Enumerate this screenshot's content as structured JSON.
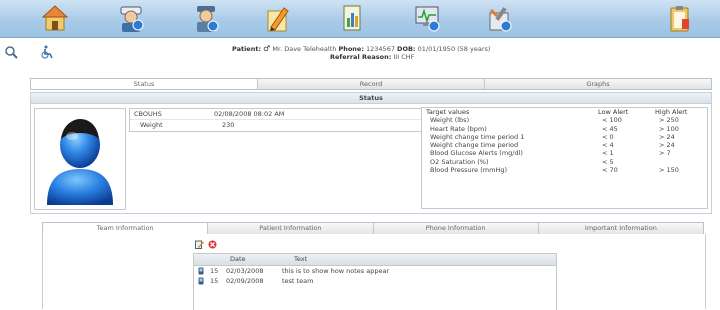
{
  "toolbar": {
    "icons": [
      "home-icon",
      "nurse-settings-icon",
      "doctor-settings-icon",
      "edit-icon",
      "chart-report-icon",
      "monitor-icon",
      "tools-icon",
      "clipboard-icon"
    ]
  },
  "patient": {
    "label": "Patient:",
    "gender_symbol": "♂",
    "name": "Mr. Dave Telehealth",
    "phone_label": "Phone:",
    "phone": "1234567",
    "dob_label": "DOB:",
    "dob": "01/01/1950 (58 years)",
    "referral_label": "Referral Reason:",
    "referral": "III CHF"
  },
  "main_tabs": [
    "Status",
    "Record",
    "Graphs"
  ],
  "status": {
    "header": "Status",
    "vitals": [
      {
        "label": "CBOUHS",
        "value": "02/08/2008 08:02 AM"
      },
      {
        "label": "Weight",
        "value": "230"
      }
    ],
    "targets": {
      "headers": [
        "Target values",
        "Low Alert",
        "High Alert"
      ],
      "rows": [
        {
          "label": "Weight (lbs)",
          "low": "< 100",
          "high": "> 250"
        },
        {
          "label": "Heart Rate (bpm)",
          "low": "< 45",
          "high": "> 100"
        },
        {
          "label": "Weight change time period 1",
          "low": "< 0",
          "high": "> 24"
        },
        {
          "label": "Weight change time period",
          "low": "< 4",
          "high": "> 24"
        },
        {
          "label": "Blood Glucose Alerts (mg/dl)",
          "low": "< 1",
          "high": "> 7"
        },
        {
          "label": "O2 Saturation (%)",
          "low": "< 5",
          "high": ""
        },
        {
          "label": "Blood Pressure (mmHg)",
          "low": "< 70",
          "high": "> 150"
        }
      ]
    }
  },
  "bottom_tabs": [
    "Team Information",
    "Patient Information",
    "Phone Information",
    "Important Information"
  ],
  "notes": {
    "headers": [
      "Date",
      "Text"
    ],
    "rows": [
      {
        "id": "15",
        "date": "02/03/2008",
        "text": "this is to show how notes appear"
      },
      {
        "id": "15",
        "date": "02/09/2008",
        "text": "test team"
      }
    ]
  },
  "colors": {
    "toolbar_bg": "#a9cbe8",
    "avatar_blue": "#1e6fd9",
    "panel_border": "#c6d0d8"
  }
}
